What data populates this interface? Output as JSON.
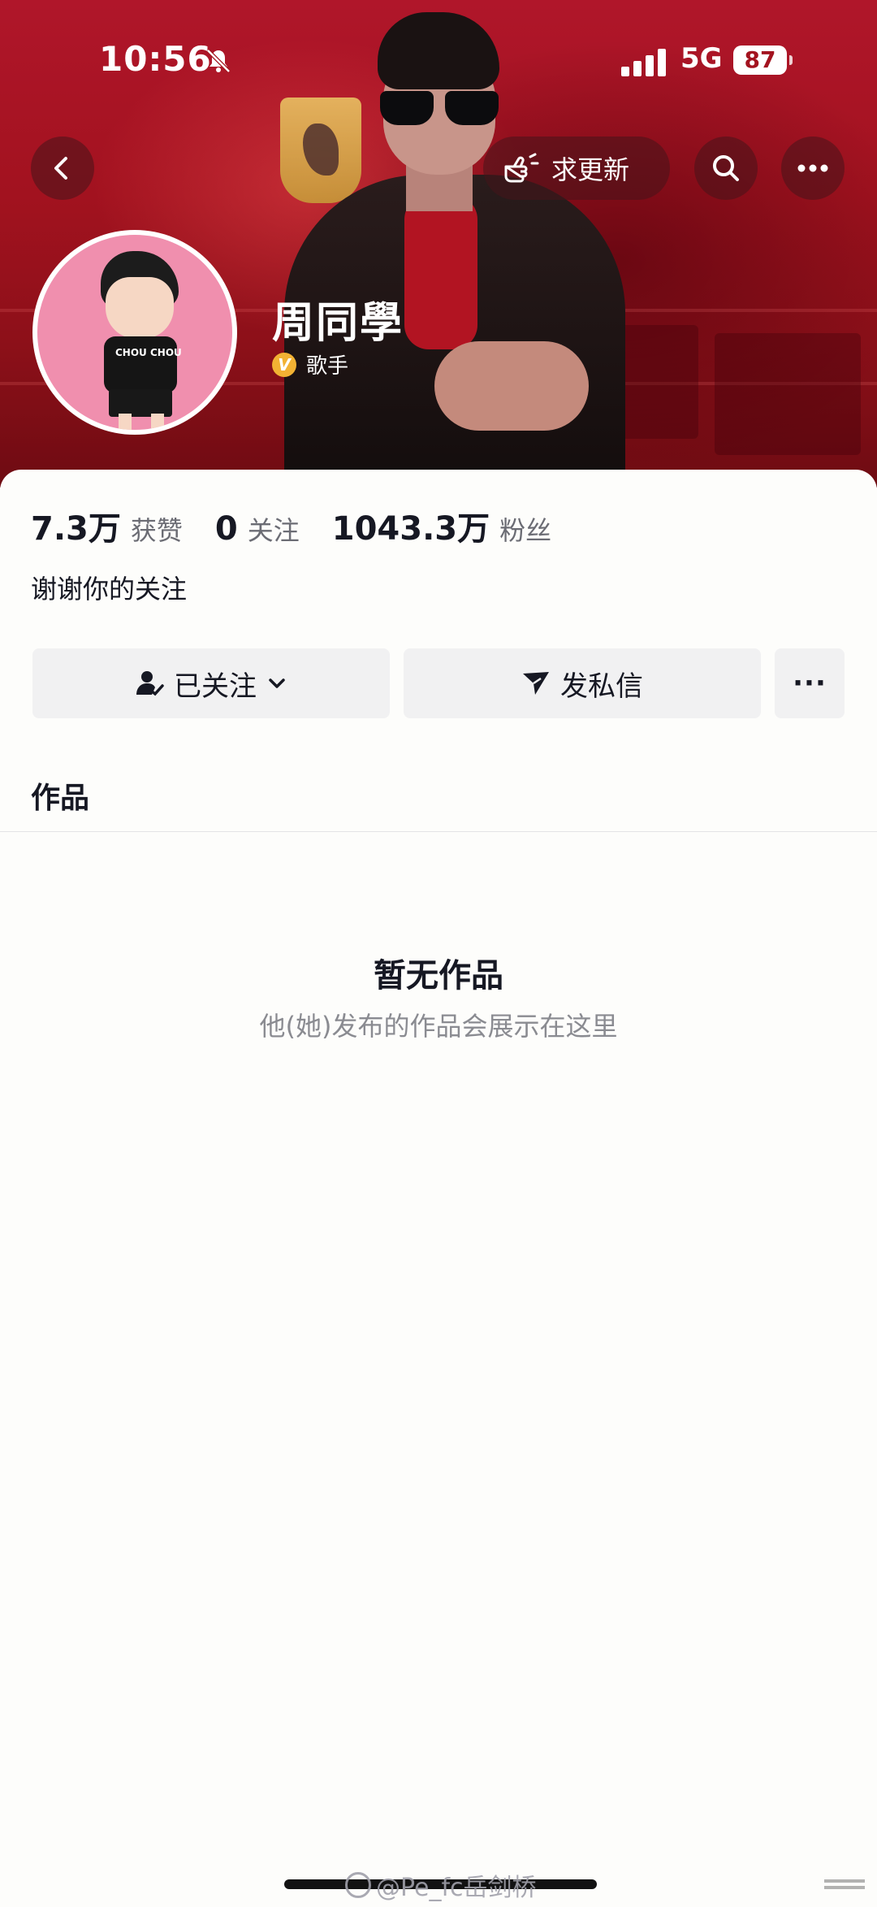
{
  "status_bar": {
    "time": "10:56",
    "network": "5G",
    "battery": "87"
  },
  "header": {
    "request_update_label": "求更新",
    "back_icon": "chevron-left-icon",
    "search_icon": "search-icon",
    "more_icon": "more-horizontal-icon"
  },
  "profile": {
    "name": "周同學",
    "verified_badge": "V",
    "verification_title": "歌手",
    "bio": "谢谢你的关注",
    "avatar_text": "CHOU CHOU",
    "stats": [
      {
        "value": "7.3万",
        "label": "获赞"
      },
      {
        "value": "0",
        "label": "关注"
      },
      {
        "value": "1043.3万",
        "label": "粉丝"
      }
    ]
  },
  "actions": {
    "followed_label": "已关注",
    "message_label": "发私信",
    "more_label": "···"
  },
  "tabs": {
    "works_label": "作品"
  },
  "empty_state": {
    "title": "暂无作品",
    "subtitle": "他(她)发布的作品会展示在这里"
  },
  "watermark": {
    "text": "@Pe_fc岳剑桥"
  },
  "colors": {
    "banner_red": "#a2121f",
    "verify_gold": "#f2b233",
    "button_bg": "#f1f1f2"
  }
}
